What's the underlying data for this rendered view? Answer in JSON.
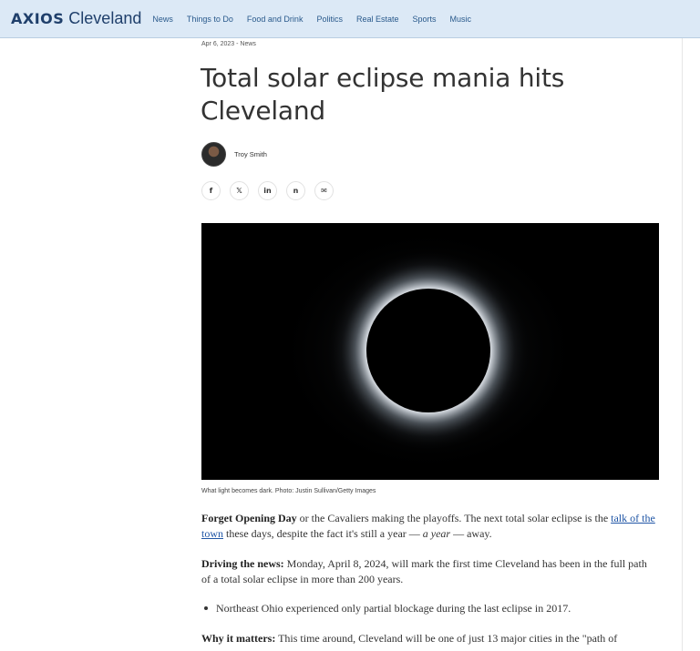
{
  "header": {
    "brand_logo": "AXIOS",
    "brand_city": "Cleveland",
    "nav": [
      "News",
      "Things to Do",
      "Food and Drink",
      "Politics",
      "Real Estate",
      "Sports",
      "Music"
    ]
  },
  "article": {
    "meta": "Apr 6, 2023 - News",
    "title": "Total solar eclipse mania hits Cleveland",
    "author": "Troy Smith",
    "share_icons": [
      "facebook-icon",
      "x-icon",
      "linkedin-icon",
      "newsletter-icon",
      "email-icon"
    ],
    "share_glyphs": [
      "f",
      "𝕏",
      "in",
      "n",
      "✉"
    ],
    "caption": "What light becomes dark. Photo: Justin Sullivan/Getty Images",
    "p1": {
      "lead": "Forget Opening Day",
      "before_link": " or the Cavaliers making the playoffs. The next total solar eclipse is the ",
      "link": "talk of the town",
      "mid": " these days, despite the fact it's still a year — ",
      "italic": "a year",
      "after": " — away."
    },
    "p2": {
      "lead": "Driving the news:",
      "text": " Monday, April 8, 2024, will mark the first time Cleveland has been in the full path of a total solar eclipse in more than 200 years."
    },
    "bullet": "Northeast Ohio experienced only partial blockage during the last eclipse in 2017.",
    "p3": {
      "lead": "Why it matters:",
      "text": " This time around, Cleveland will be one of just 13 major cities in the \"path of"
    }
  },
  "colors": {
    "header_bg": "#dce9f6",
    "brand": "#1f3f6b",
    "nav_link": "#2a5a8c",
    "link": "#1f55a5"
  }
}
